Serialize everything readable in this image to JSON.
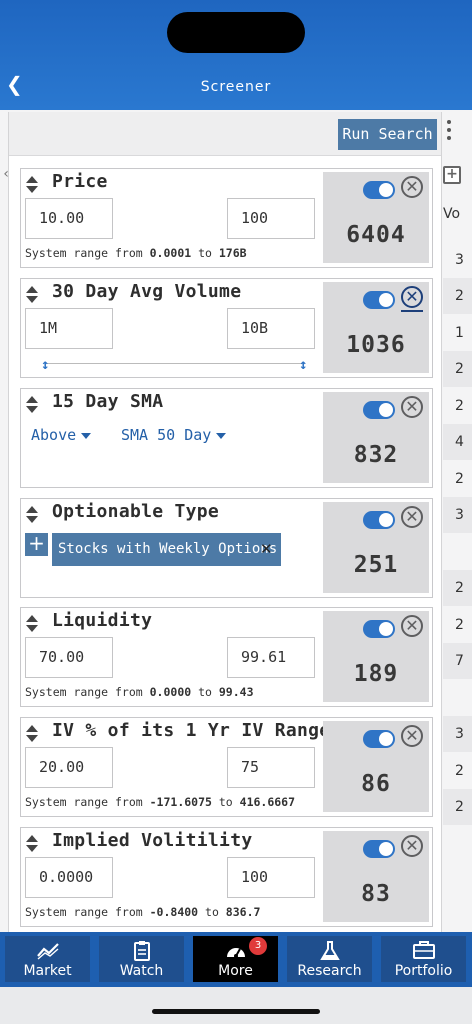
{
  "header": {
    "title": "Screener"
  },
  "toolbar": {
    "run_label": "Run Search"
  },
  "background_table": {
    "column_header": "Vo",
    "cells": [
      "3",
      "2",
      "1",
      "2",
      "2",
      "4",
      "2",
      "3",
      "",
      "2",
      "2",
      "7",
      "",
      "3",
      "2",
      "2"
    ]
  },
  "criteria": [
    {
      "name": "Price",
      "min": "10.00",
      "max": "100",
      "range_prefix": "System range from ",
      "range_min": "0.0001",
      "range_sep": " to ",
      "range_max": "176B",
      "count": "6404",
      "enabled": true
    },
    {
      "name": "30 Day Avg Volume",
      "min": "1M",
      "max": "10B",
      "count": "1036",
      "enabled": true
    },
    {
      "name": "15 Day SMA",
      "comparison": "Above",
      "reference": "SMA 50 Day",
      "count": "832",
      "enabled": true
    },
    {
      "name": "Optionable Type",
      "tag": "Stocks with Weekly Options",
      "count": "251",
      "enabled": true
    },
    {
      "name": "Liquidity",
      "min": "70.00",
      "max": "99.61",
      "range_prefix": "System range from ",
      "range_min": "0.0000",
      "range_sep": " to ",
      "range_max": "99.43",
      "count": "189",
      "enabled": true
    },
    {
      "name": "IV % of its 1 Yr IV Range",
      "min": "20.00",
      "max": "75",
      "range_prefix": "System range from ",
      "range_min": "-171.6075",
      "range_sep": " to ",
      "range_max": "416.6667",
      "count": "86",
      "enabled": true
    },
    {
      "name": "Implied Volitility",
      "min": "0.0000",
      "max": "100",
      "range_prefix": "System range from ",
      "range_min": "-0.8400",
      "range_sep": " to ",
      "range_max": "836.7",
      "count": "83",
      "enabled": true
    }
  ],
  "tabs": [
    {
      "label": "Market",
      "icon": "chart-line-icon"
    },
    {
      "label": "Watch",
      "icon": "clipboard-icon"
    },
    {
      "label": "More",
      "icon": "gauge-icon",
      "badge": "3",
      "active": true
    },
    {
      "label": "Research",
      "icon": "flask-icon"
    },
    {
      "label": "Portfolio",
      "icon": "briefcase-icon"
    }
  ],
  "colors": {
    "header": "#1f66c0",
    "accent": "#4d7aa6",
    "toggle_on": "#2f74c6",
    "tab_active": "#000000",
    "badge": "#e03a3a"
  }
}
